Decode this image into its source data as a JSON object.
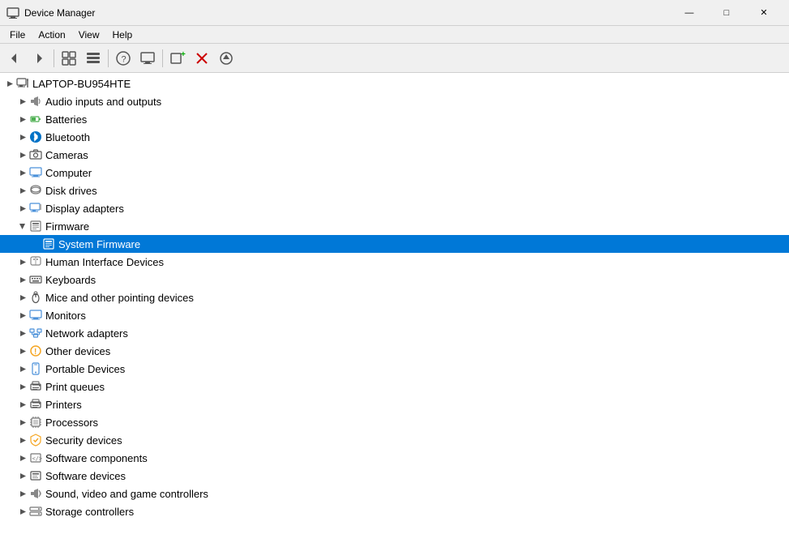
{
  "window": {
    "title": "Device Manager",
    "icon": "🖥"
  },
  "titlebar": {
    "minimize_label": "—",
    "maximize_label": "□",
    "close_label": "✕"
  },
  "menu": {
    "items": [
      {
        "label": "File",
        "id": "file"
      },
      {
        "label": "Action",
        "id": "action"
      },
      {
        "label": "View",
        "id": "view"
      },
      {
        "label": "Help",
        "id": "help"
      }
    ]
  },
  "toolbar": {
    "buttons": [
      {
        "id": "back",
        "icon": "◀",
        "tooltip": "Back",
        "disabled": false
      },
      {
        "id": "forward",
        "icon": "▶",
        "tooltip": "Forward",
        "disabled": false
      },
      {
        "id": "show-devices",
        "icon": "📋",
        "tooltip": "Show devices by type",
        "disabled": false
      },
      {
        "id": "show-resources",
        "icon": "📄",
        "tooltip": "Show resources by type",
        "disabled": false
      },
      {
        "id": "help",
        "icon": "?",
        "tooltip": "Help",
        "disabled": false
      },
      {
        "id": "display",
        "icon": "🖥",
        "tooltip": "Display",
        "disabled": false
      },
      {
        "id": "add-driver",
        "icon": "➕",
        "tooltip": "Add driver",
        "disabled": false
      },
      {
        "id": "remove",
        "icon": "❌",
        "tooltip": "Remove device",
        "disabled": false
      },
      {
        "id": "update",
        "icon": "⬇",
        "tooltip": "Update driver",
        "disabled": false
      }
    ]
  },
  "tree": {
    "root": {
      "label": "LAPTOP-BU954HTE",
      "expanded": true,
      "selected": false,
      "children": [
        {
          "id": "audio",
          "label": "Audio inputs and outputs",
          "icon": "audio",
          "expanded": false,
          "selected": false
        },
        {
          "id": "batteries",
          "label": "Batteries",
          "icon": "battery",
          "expanded": false,
          "selected": false
        },
        {
          "id": "bluetooth",
          "label": "Bluetooth",
          "icon": "bluetooth",
          "expanded": false,
          "selected": false
        },
        {
          "id": "cameras",
          "label": "Cameras",
          "icon": "camera",
          "expanded": false,
          "selected": false
        },
        {
          "id": "computer",
          "label": "Computer",
          "icon": "computer",
          "expanded": false,
          "selected": false
        },
        {
          "id": "disk",
          "label": "Disk drives",
          "icon": "disk",
          "expanded": false,
          "selected": false
        },
        {
          "id": "display",
          "label": "Display adapters",
          "icon": "display",
          "expanded": false,
          "selected": false
        },
        {
          "id": "firmware",
          "label": "Firmware",
          "icon": "firmware",
          "expanded": true,
          "selected": false,
          "children": [
            {
              "id": "system-firmware",
              "label": "System Firmware",
              "icon": "firmware",
              "selected": true
            }
          ]
        },
        {
          "id": "hid",
          "label": "Human Interface Devices",
          "icon": "hid",
          "expanded": false,
          "selected": false
        },
        {
          "id": "keyboards",
          "label": "Keyboards",
          "icon": "keyboard",
          "expanded": false,
          "selected": false
        },
        {
          "id": "mice",
          "label": "Mice and other pointing devices",
          "icon": "mouse",
          "expanded": false,
          "selected": false
        },
        {
          "id": "monitors",
          "label": "Monitors",
          "icon": "monitor",
          "expanded": false,
          "selected": false
        },
        {
          "id": "network",
          "label": "Network adapters",
          "icon": "network",
          "expanded": false,
          "selected": false
        },
        {
          "id": "other",
          "label": "Other devices",
          "icon": "other",
          "expanded": false,
          "selected": false
        },
        {
          "id": "portable",
          "label": "Portable Devices",
          "icon": "portable",
          "expanded": false,
          "selected": false
        },
        {
          "id": "print-queues",
          "label": "Print queues",
          "icon": "print",
          "expanded": false,
          "selected": false
        },
        {
          "id": "printers",
          "label": "Printers",
          "icon": "printer",
          "expanded": false,
          "selected": false
        },
        {
          "id": "processors",
          "label": "Processors",
          "icon": "processor",
          "expanded": false,
          "selected": false
        },
        {
          "id": "security",
          "label": "Security devices",
          "icon": "security",
          "expanded": false,
          "selected": false
        },
        {
          "id": "softcomp",
          "label": "Software components",
          "icon": "softcomp",
          "expanded": false,
          "selected": false
        },
        {
          "id": "softdev",
          "label": "Software devices",
          "icon": "softdev",
          "expanded": false,
          "selected": false
        },
        {
          "id": "sound",
          "label": "Sound, video and game controllers",
          "icon": "sound",
          "expanded": false,
          "selected": false
        },
        {
          "id": "storage",
          "label": "Storage controllers",
          "icon": "storage",
          "expanded": false,
          "selected": false
        }
      ]
    }
  }
}
